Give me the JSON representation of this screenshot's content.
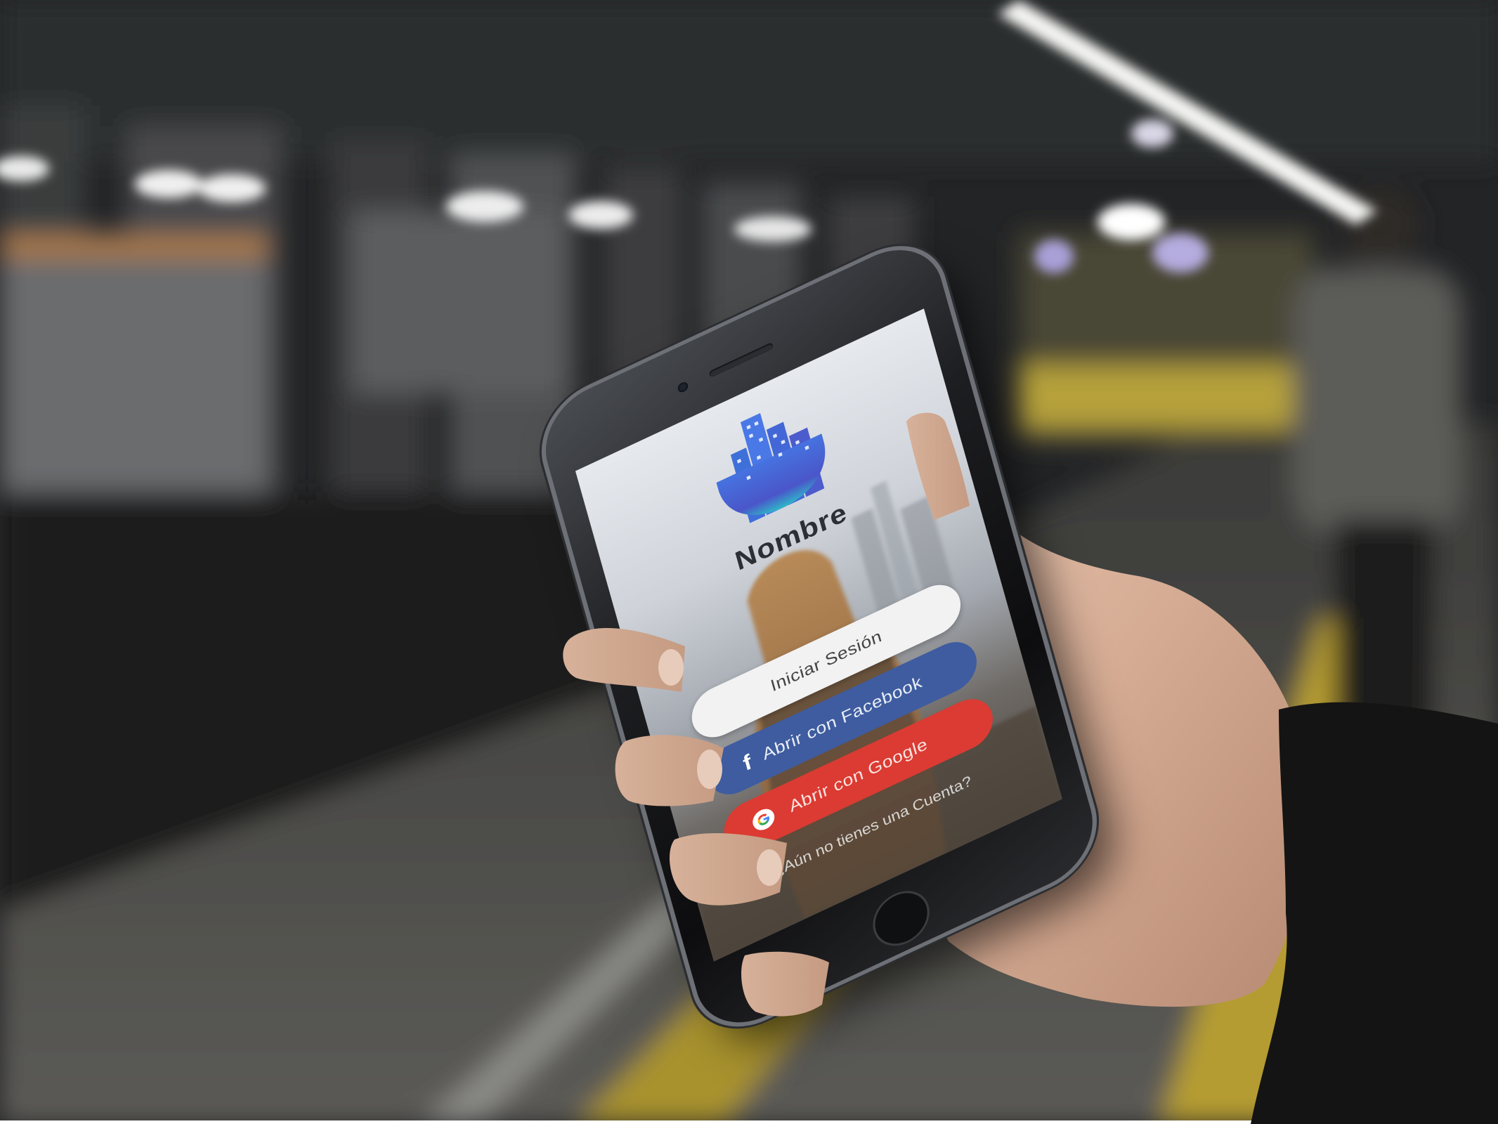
{
  "app": {
    "name": "Nombre"
  },
  "buttons": {
    "login_label": "Iniciar Sesión",
    "facebook_label": "Abrir con Facebook",
    "google_label": "Abrir con Google"
  },
  "footer": {
    "signup_prompt": "¿Aún no tienes una Cuenta?"
  },
  "icons": {
    "logo": "city-buildings-logo",
    "facebook": "facebook-icon",
    "google": "google-icon"
  },
  "colors": {
    "login_button_bg": "#f2f2f2",
    "facebook_button_bg": "#3e5c9f",
    "google_button_bg": "#db3b32",
    "logo_blue": "#3f6fd8",
    "logo_teal": "#2fb6c9"
  }
}
